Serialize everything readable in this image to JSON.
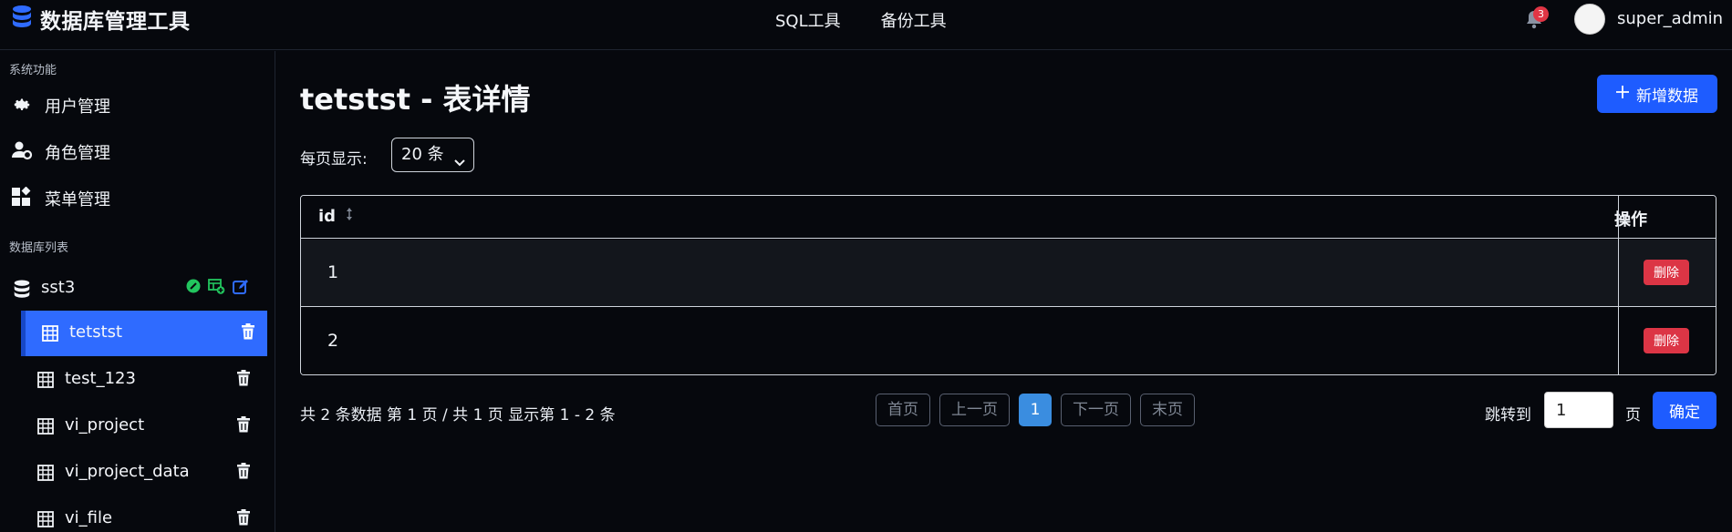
{
  "app": {
    "title": "数据库管理工具",
    "nav": [
      "SQL工具",
      "备份工具"
    ],
    "notifications": "3",
    "username": "super_admin"
  },
  "sidebar": {
    "system_section": "系统功能",
    "system_items": [
      {
        "label": "用户管理",
        "icon": "gear-icon"
      },
      {
        "label": "角色管理",
        "icon": "user-gear-icon"
      },
      {
        "label": "菜单管理",
        "icon": "widgets-icon"
      }
    ],
    "db_section": "数据库列表",
    "database": {
      "name": "sst3"
    },
    "tables": [
      {
        "label": "tetstst",
        "active": true
      },
      {
        "label": "test_123",
        "active": false
      },
      {
        "label": "vi_project",
        "active": false
      },
      {
        "label": "vi_project_data",
        "active": false
      },
      {
        "label": "vi_file",
        "active": false
      }
    ]
  },
  "main": {
    "page_title": "tetstst - 表详情",
    "add_button": "新增数据",
    "per_page_label": "每页显示:",
    "per_page_value": "20 条",
    "table": {
      "columns": [
        "id",
        "操作"
      ],
      "rows": [
        {
          "id": "1",
          "action": "删除"
        },
        {
          "id": "2",
          "action": "删除"
        }
      ]
    },
    "summary": "共 2 条数据 第 1 页 / 共 1 页 显示第 1 - 2 条",
    "pager": {
      "first": "首页",
      "prev": "上一页",
      "current": "1",
      "next": "下一页",
      "last": "末页"
    },
    "jump_label": "跳转到",
    "jump_value": "1",
    "page_unit": "页",
    "confirm": "确定"
  },
  "colors": {
    "accent": "#1e5cff",
    "active_item": "#2f6bff",
    "danger": "#dc3545",
    "success": "#22c55e"
  }
}
